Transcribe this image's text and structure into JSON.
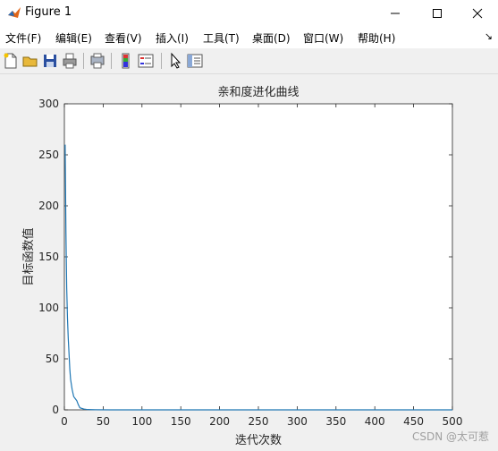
{
  "window": {
    "title": "Figure 1"
  },
  "menu": [
    {
      "label": "文件(F)"
    },
    {
      "label": "编辑(E)"
    },
    {
      "label": "查看(V)"
    },
    {
      "label": "插入(I)"
    },
    {
      "label": "工具(T)"
    },
    {
      "label": "桌面(D)"
    },
    {
      "label": "窗口(W)"
    },
    {
      "label": "帮助(H)"
    }
  ],
  "toolbar_icons": [
    "new-figure-icon",
    "open-file-icon",
    "save-icon",
    "print-icon",
    "print-preview-icon",
    "colorbar-icon",
    "legend-icon",
    "pointer-icon",
    "property-editor-icon"
  ],
  "colors": {
    "line": "#1f77b4",
    "axes_bg": "#ffffff",
    "figure_bg": "#f0f0f0"
  },
  "chart_data": {
    "type": "line",
    "title": "亲和度进化曲线",
    "xlabel": "迭代次数",
    "ylabel": "目标函数值",
    "xlim": [
      0,
      500
    ],
    "ylim": [
      0,
      300
    ],
    "xticks": [
      0,
      50,
      100,
      150,
      200,
      250,
      300,
      350,
      400,
      450,
      500
    ],
    "yticks": [
      0,
      50,
      100,
      150,
      200,
      250,
      300
    ],
    "grid": false,
    "series": [
      {
        "x": [
          1,
          2,
          3,
          4,
          5,
          6,
          7,
          8,
          10,
          12,
          14,
          16,
          18,
          20,
          25,
          30,
          40,
          60,
          100,
          200,
          300,
          400,
          500
        ],
        "y": [
          260,
          175,
          120,
          90,
          70,
          55,
          40,
          30,
          20,
          13,
          11,
          9,
          5,
          2,
          0.8,
          0.3,
          0.1,
          0.02,
          0,
          0,
          0,
          0,
          0
        ]
      }
    ]
  },
  "watermark": "CSDN @太可惹"
}
